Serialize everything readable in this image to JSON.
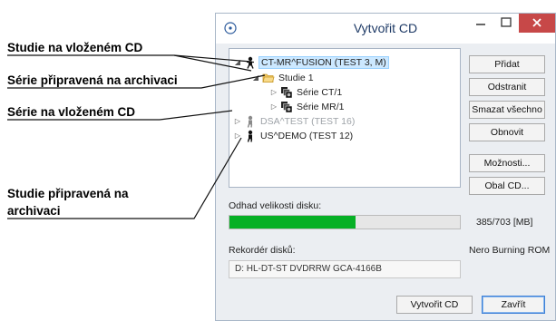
{
  "annotations": {
    "study_on_cd": "Studie na vloženém CD",
    "series_for_archive": "Série připravená na archivaci",
    "series_on_cd": "Série na vloženém CD",
    "study_for_archive_line1": "Studie připravená na",
    "study_for_archive_line2": "archivaci"
  },
  "window": {
    "title": "Vytvořit CD",
    "title_color": "#1e3a66",
    "close_color": "#c74848"
  },
  "tree": [
    {
      "label": "CT-MR^FUSION (TEST 3, M)",
      "expander": "◢",
      "icon": "patient-icon",
      "state": "selected"
    },
    {
      "label": "Studie 1",
      "expander": "◢",
      "icon": "folder-open-icon",
      "state": "normal"
    },
    {
      "label": "Série CT/1",
      "expander": "▷",
      "icon": "series-icon",
      "state": "normal"
    },
    {
      "label": "Série MR/1",
      "expander": "▷",
      "icon": "series-icon",
      "state": "normal"
    },
    {
      "label": "DSA^TEST (TEST 16)",
      "expander": "▷",
      "icon": "patient-icon",
      "state": "disabled"
    },
    {
      "label": "US^DEMO (TEST 12)",
      "expander": "▷",
      "icon": "patient-icon",
      "state": "normal"
    }
  ],
  "buttons": {
    "add": "Přidat",
    "remove": "Odstranit",
    "clear_all": "Smazat všechno",
    "refresh": "Obnovit",
    "options": "Možnosti...",
    "cover": "Obal CD...",
    "create": "Vytvořit CD",
    "close": "Zavřít"
  },
  "disk": {
    "label": "Odhad velikosti disku:",
    "used": 385,
    "total": 703,
    "value_text": "385/703 [MB]",
    "fill_color": "#06b025"
  },
  "recorder": {
    "label": "Rekordér disků:",
    "software": "Nero Burning ROM",
    "device": "D: HL-DT-ST DVDRRW GCA-4166B"
  }
}
